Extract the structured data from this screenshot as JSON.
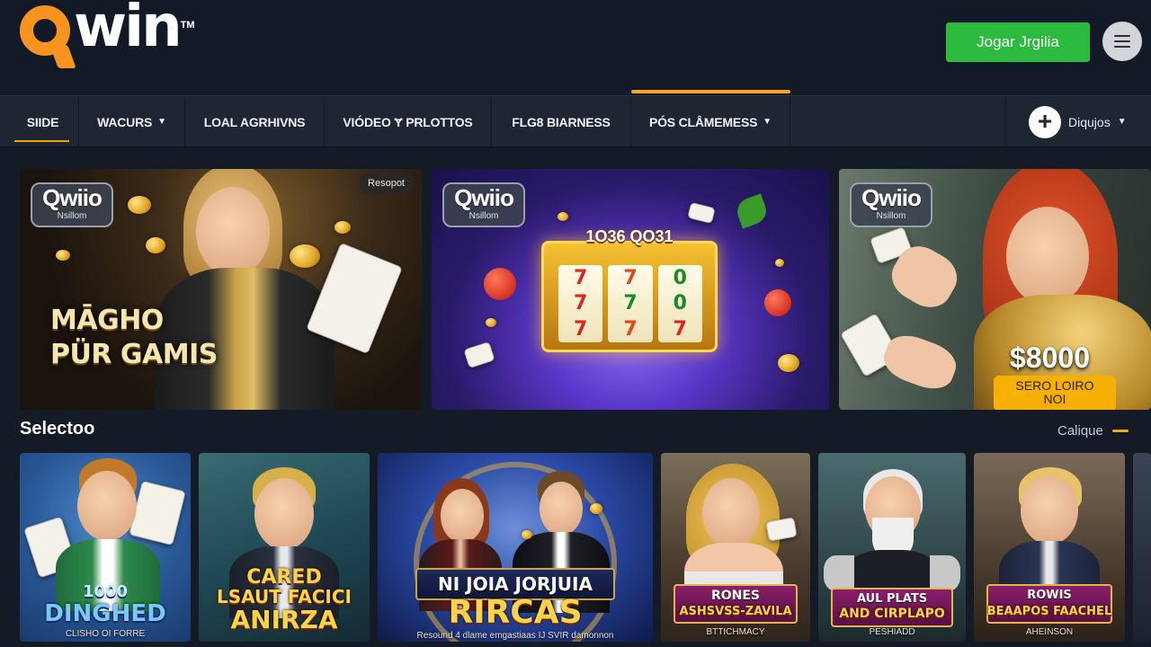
{
  "header": {
    "logo_text": "win",
    "logo_tm": "TM",
    "cta_label": "Jogar Jrgilia",
    "menu_icon": "hamburger-icon"
  },
  "nav": {
    "items": [
      {
        "label": "SIIDE",
        "active": true,
        "dropdown": false
      },
      {
        "label": "WACURS",
        "active": false,
        "dropdown": true
      },
      {
        "label": "LOAL AGRHIVNS",
        "active": false,
        "dropdown": false
      },
      {
        "label": "VIÓDEO Ɏ PRLOTTOS",
        "active": false,
        "dropdown": false
      },
      {
        "label": "FLG8 BIARNESS",
        "active": false,
        "dropdown": false
      },
      {
        "label": "PÓS CLÅMEMESS",
        "active": false,
        "dropdown": true
      }
    ],
    "right_label": "Diqujos",
    "right_icon": "plus-icon"
  },
  "banners": [
    {
      "badge_title": "Qwiio",
      "badge_sub": "Nsillom",
      "tag": "Resopot",
      "headline_1": "MĀGHO",
      "headline_2": "PÜR GAMIS"
    },
    {
      "badge_title": "Qwiio",
      "badge_sub": "Nsillom",
      "slot_title": "1O36 QO31",
      "reels": [
        [
          "7",
          "7",
          "7"
        ],
        [
          "7",
          "7",
          "7"
        ],
        [
          "0",
          "0",
          "7"
        ]
      ]
    },
    {
      "badge_title": "Qwiio",
      "badge_sub": "Nsillom",
      "prize": "$8000",
      "prize_btn_1": "SERO LOIRO",
      "prize_btn_2": "NOI"
    }
  ],
  "section": {
    "title": "Selectoo",
    "link": "Calique"
  },
  "tiles": [
    {
      "title_1": "1000",
      "title_2": "DINGHED",
      "sub": "CLISHO OI FORRE"
    },
    {
      "title_1": "CARED",
      "title_2": "LSAUT FACICI",
      "title_3": "ANIRZA"
    },
    {
      "title_1": "NI JOIA JORJUIA",
      "title_2": "RIRCAS",
      "sub": "Resound 4 dlame emgastiaas IJ SVIR damonnon"
    },
    {
      "title_1": "RONES",
      "title_2": "ASHSVSS-ZAVILA",
      "sub": "BTTICHMACY"
    },
    {
      "title_1": "AUL PLATS",
      "title_2": "AND CIRPLAPO",
      "sub": "PESHIADD"
    },
    {
      "title_1": "ROWIS",
      "title_2": "BEAAPOS FAACHEL",
      "sub": "AHEINSON"
    }
  ],
  "colors": {
    "accent": "#f5a623",
    "cta": "#2dbb3f",
    "logo_orange": "#f7941d",
    "bg": "#141a26",
    "nav_bg": "#1e2634"
  }
}
